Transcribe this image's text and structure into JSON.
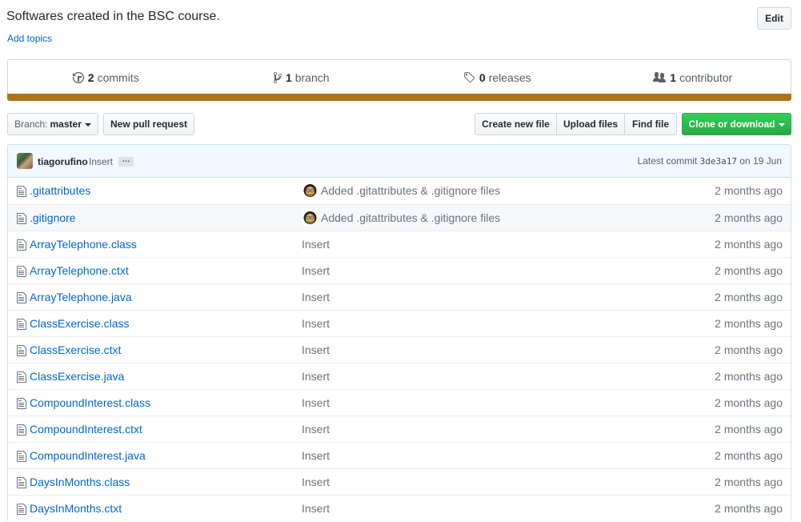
{
  "repo": {
    "description": "Softwares created in the BSC course.",
    "add_topics": "Add topics",
    "edit_label": "Edit"
  },
  "summary": {
    "commits_count": "2",
    "commits_label": "commits",
    "branch_count": "1",
    "branch_label": "branch",
    "releases_count": "0",
    "releases_label": "releases",
    "contributor_count": "1",
    "contributor_label": "contributor",
    "language_color": "#b07219"
  },
  "toolbar": {
    "branch_prefix": "Branch:",
    "branch_name": "master",
    "new_pr": "New pull request",
    "create_file": "Create new file",
    "upload_files": "Upload files",
    "find_file": "Find file",
    "clone": "Clone or download",
    "clone_color": "#28a745"
  },
  "latest_commit": {
    "author": "tiagorufino",
    "message": "Insert",
    "ellipsis": "…",
    "prefix": "Latest commit",
    "sha": "3de3a17",
    "date": "on 19 Jun"
  },
  "files": [
    {
      "name": ".gitattributes",
      "message": "Added .gitattributes & .gitignore files",
      "age": "2 months ago",
      "avatar": true
    },
    {
      "name": ".gitignore",
      "message": "Added .gitattributes & .gitignore files",
      "age": "2 months ago",
      "avatar": true
    },
    {
      "name": "ArrayTelephone.class",
      "message": "Insert",
      "age": "2 months ago",
      "avatar": false
    },
    {
      "name": "ArrayTelephone.ctxt",
      "message": "Insert",
      "age": "2 months ago",
      "avatar": false
    },
    {
      "name": "ArrayTelephone.java",
      "message": "Insert",
      "age": "2 months ago",
      "avatar": false
    },
    {
      "name": "ClassExercise.class",
      "message": "Insert",
      "age": "2 months ago",
      "avatar": false
    },
    {
      "name": "ClassExercise.ctxt",
      "message": "Insert",
      "age": "2 months ago",
      "avatar": false
    },
    {
      "name": "ClassExercise.java",
      "message": "Insert",
      "age": "2 months ago",
      "avatar": false
    },
    {
      "name": "CompoundInterest.class",
      "message": "Insert",
      "age": "2 months ago",
      "avatar": false
    },
    {
      "name": "CompoundInterest.ctxt",
      "message": "Insert",
      "age": "2 months ago",
      "avatar": false
    },
    {
      "name": "CompoundInterest.java",
      "message": "Insert",
      "age": "2 months ago",
      "avatar": false
    },
    {
      "name": "DaysInMonths.class",
      "message": "Insert",
      "age": "2 months ago",
      "avatar": false
    },
    {
      "name": "DaysInMonths.ctxt",
      "message": "Insert",
      "age": "2 months ago",
      "avatar": false
    }
  ],
  "icons": {
    "file": "file-icon",
    "commits": "history-icon",
    "branch": "git-branch-icon",
    "releases": "tag-icon",
    "contributors": "people-icon"
  }
}
